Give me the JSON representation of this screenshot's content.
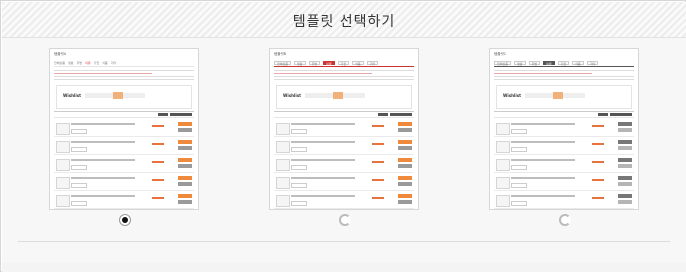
{
  "header": {
    "title": "템플릿 선택하기"
  },
  "templates": [
    {
      "label": "템플릿A",
      "logo": "Wishlist",
      "tabs": [
        "전체상품",
        "생활",
        "주방",
        "의류",
        "가전",
        "식품",
        "기타"
      ],
      "active_tab": 3,
      "selected": true
    },
    {
      "label": "템플릿B",
      "logo": "Wishlist",
      "tabs": [
        "전체상품",
        "생활",
        "주방",
        "의류",
        "가전",
        "식품",
        "기타"
      ],
      "active_tab": 3,
      "selected": false
    },
    {
      "label": "템플릿C",
      "logo": "Wishlist",
      "tabs": [
        "전체상품",
        "생활",
        "주방",
        "의류",
        "가전",
        "식품",
        "기타"
      ],
      "active_tab": 3,
      "selected": false
    }
  ],
  "colors": {
    "accent": "#ef8a3c",
    "tab_active": "#cc3333",
    "gray": "#777777"
  },
  "icons": [
    "radio-selected-icon",
    "radio-unselected-icon"
  ]
}
